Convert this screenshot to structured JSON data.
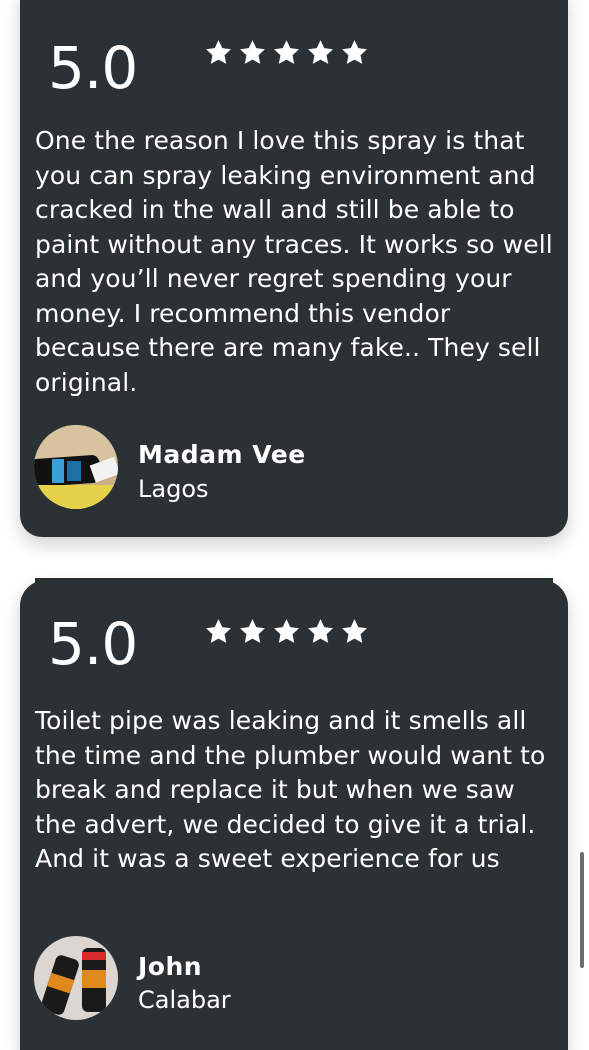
{
  "reviews": [
    {
      "score": "5.0",
      "stars": 5,
      "text": "One the reason I love this spray is that you can spray leaking environment and cracked in the wall and still be able to paint without any traces. It works so well and you’ll never regret spending your money. I recommend this vendor because there are many fake.. They sell original.",
      "name": "Madam Vee",
      "location": "Lagos"
    },
    {
      "score": "5.0",
      "stars": 5,
      "text": "Toilet pipe was leaking and it smells all the time and the plumber would want to break and replace it but when we saw the advert, we decided to give it a trial. And it was a sweet experience for us",
      "name": "John",
      "location": "Calabar"
    }
  ],
  "colors": {
    "card_bg": "#2b3134",
    "text": "#ffffff",
    "page_bg": "#ffffff"
  },
  "icons": [
    "star-icon",
    "avatar-photo"
  ]
}
